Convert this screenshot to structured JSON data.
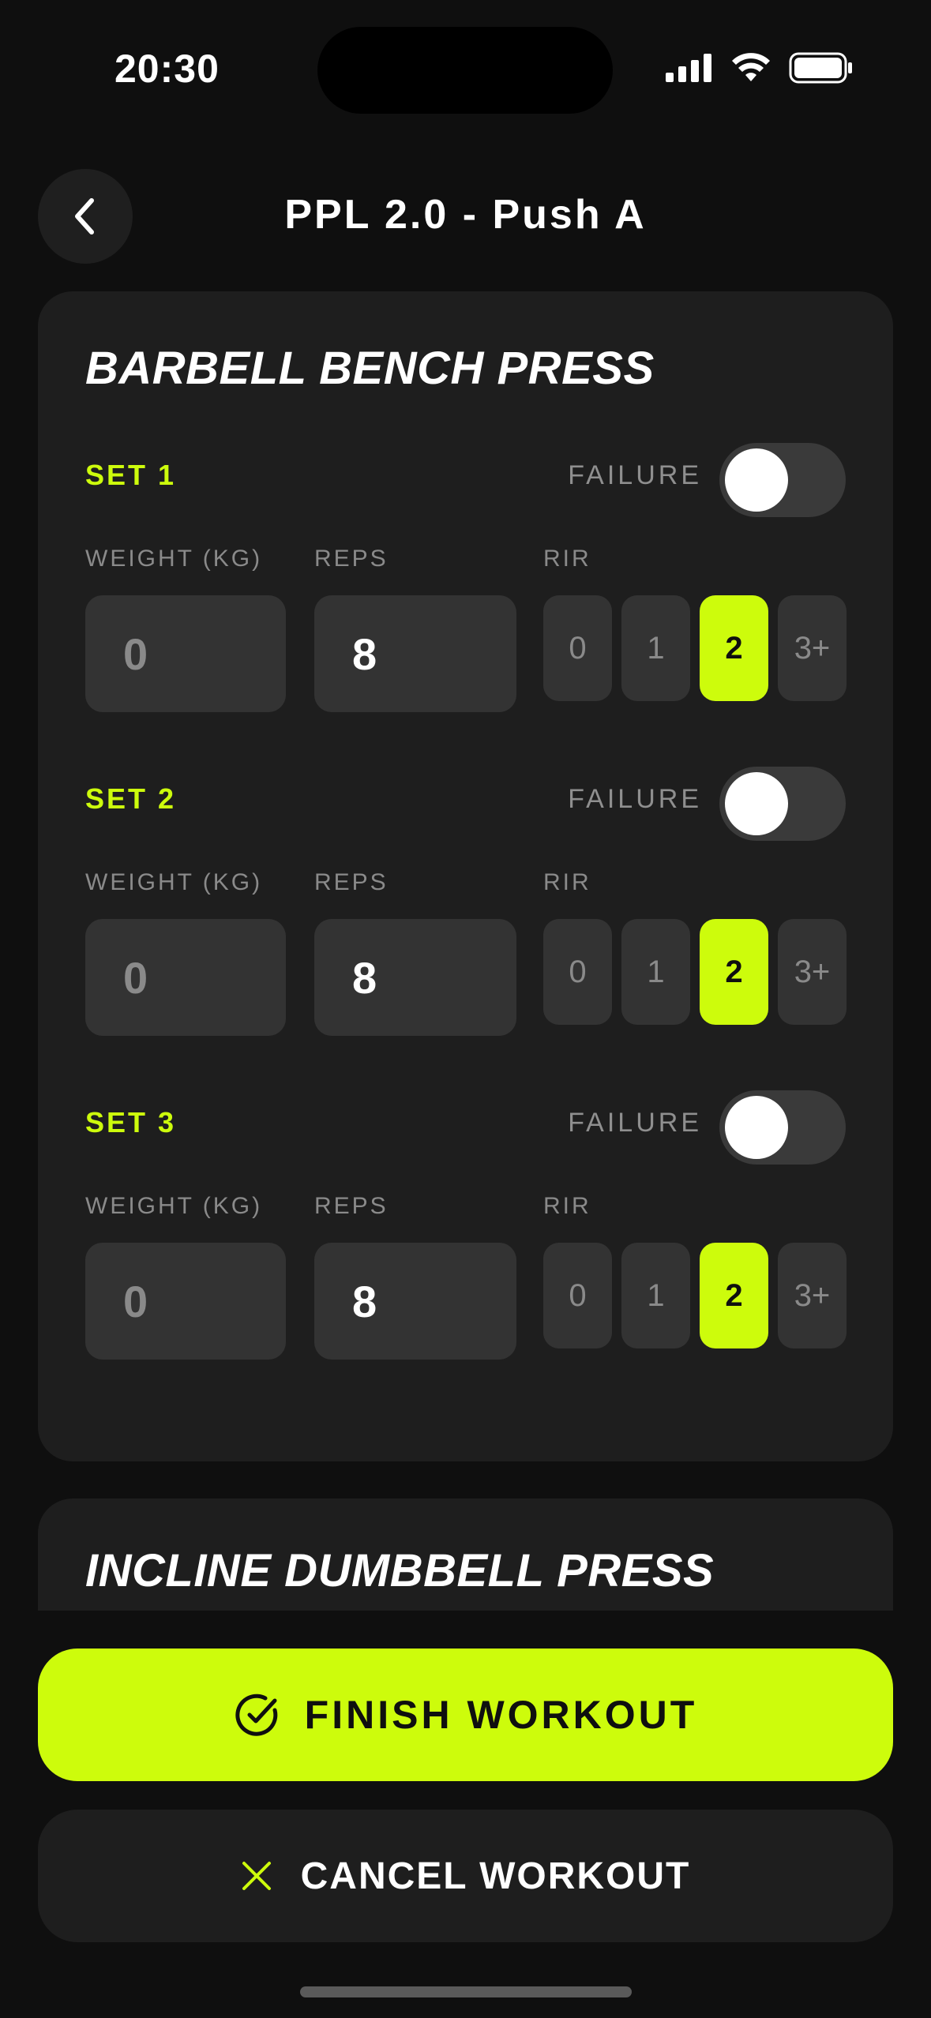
{
  "status_bar": {
    "time": "20:30"
  },
  "header": {
    "title": "PPL 2.0 - Push A"
  },
  "exercise": {
    "title": "BARBELL BENCH PRESS",
    "failure_label": "FAILURE",
    "weight_label": "WEIGHT (KG)",
    "reps_label": "REPS",
    "rir_label": "RIR",
    "rir_options": [
      "0",
      "1",
      "2",
      "3+"
    ],
    "sets": [
      {
        "label": "SET 1",
        "weight": "0",
        "reps": "8",
        "rir_selected": "2",
        "failure": false
      },
      {
        "label": "SET 2",
        "weight": "0",
        "reps": "8",
        "rir_selected": "2",
        "failure": false
      },
      {
        "label": "SET 3",
        "weight": "0",
        "reps": "8",
        "rir_selected": "2",
        "failure": false
      }
    ]
  },
  "next_exercise": {
    "title": "INCLINE DUMBBELL PRESS"
  },
  "actions": {
    "finish_label": "FINISH WORKOUT",
    "cancel_label": "CANCEL WORKOUT"
  },
  "colors": {
    "accent": "#cdfc0c",
    "background": "#0f0f0f",
    "card": "#1e1e1e",
    "input": "#333333"
  },
  "icons": {
    "back": "chevron-left-icon",
    "finish": "check-circle-icon",
    "cancel": "close-icon"
  }
}
